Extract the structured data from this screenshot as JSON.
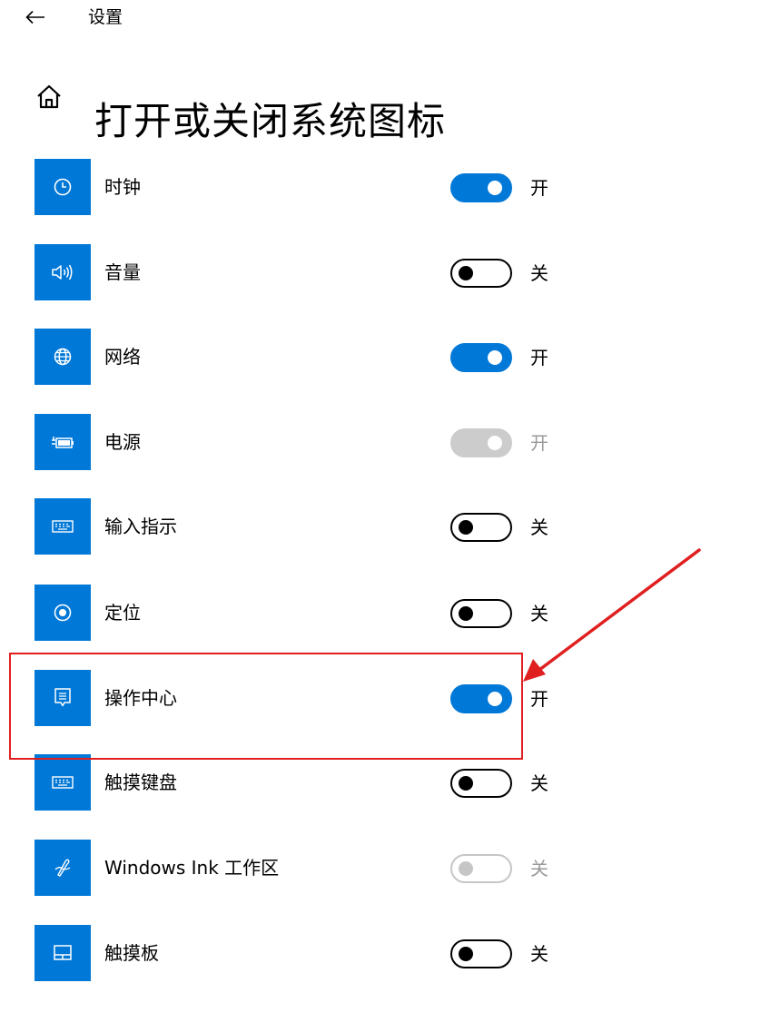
{
  "header": {
    "app_title": "设置",
    "back_icon": "back-arrow-icon"
  },
  "page": {
    "title": "打开或关闭系统图标",
    "home_icon": "home-icon"
  },
  "accent_color": "#0078d7",
  "annotation_color": "#e02020",
  "items": [
    {
      "label": "时钟",
      "icon": "clock-icon",
      "state": "开",
      "on": true,
      "enabled": true
    },
    {
      "label": "音量",
      "icon": "volume-icon",
      "state": "关",
      "on": false,
      "enabled": true
    },
    {
      "label": "网络",
      "icon": "globe-icon",
      "state": "开",
      "on": true,
      "enabled": true
    },
    {
      "label": "电源",
      "icon": "battery-icon",
      "state": "开",
      "on": true,
      "enabled": false
    },
    {
      "label": "输入指示",
      "icon": "keyboard-icon",
      "state": "关",
      "on": false,
      "enabled": true
    },
    {
      "label": "定位",
      "icon": "location-icon",
      "state": "关",
      "on": false,
      "enabled": true
    },
    {
      "label": "操作中心",
      "icon": "action-center-icon",
      "state": "开",
      "on": true,
      "enabled": true
    },
    {
      "label": "触摸键盘",
      "icon": "keyboard-icon",
      "state": "关",
      "on": false,
      "enabled": true
    },
    {
      "label": "Windows Ink 工作区",
      "icon": "pen-icon",
      "state": "关",
      "on": false,
      "enabled": false
    },
    {
      "label": "触摸板",
      "icon": "touchpad-icon",
      "state": "关",
      "on": false,
      "enabled": true
    }
  ]
}
